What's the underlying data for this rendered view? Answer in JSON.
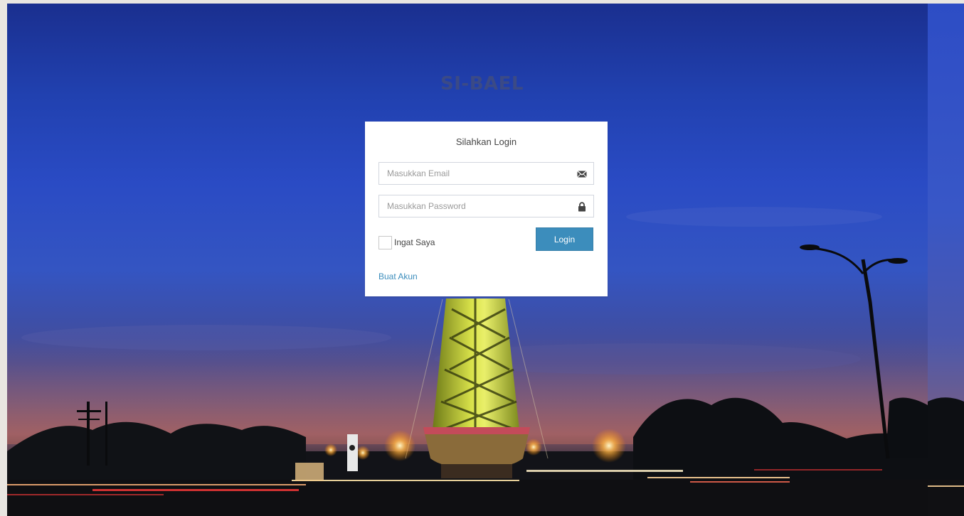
{
  "app": {
    "title": "SI-BAEL"
  },
  "login": {
    "heading": "Silahkan Login",
    "email_placeholder": "Masukkan Email",
    "password_placeholder": "Masukkan Password",
    "remember_label": "Ingat Saya",
    "submit_label": "Login",
    "create_account_label": "Buat Akun",
    "email_icon": "envelope-icon",
    "password_icon": "lock-icon"
  },
  "colors": {
    "primary_button": "#3c8dbc",
    "link": "#3c8dbc",
    "title": "#3b4a86"
  }
}
